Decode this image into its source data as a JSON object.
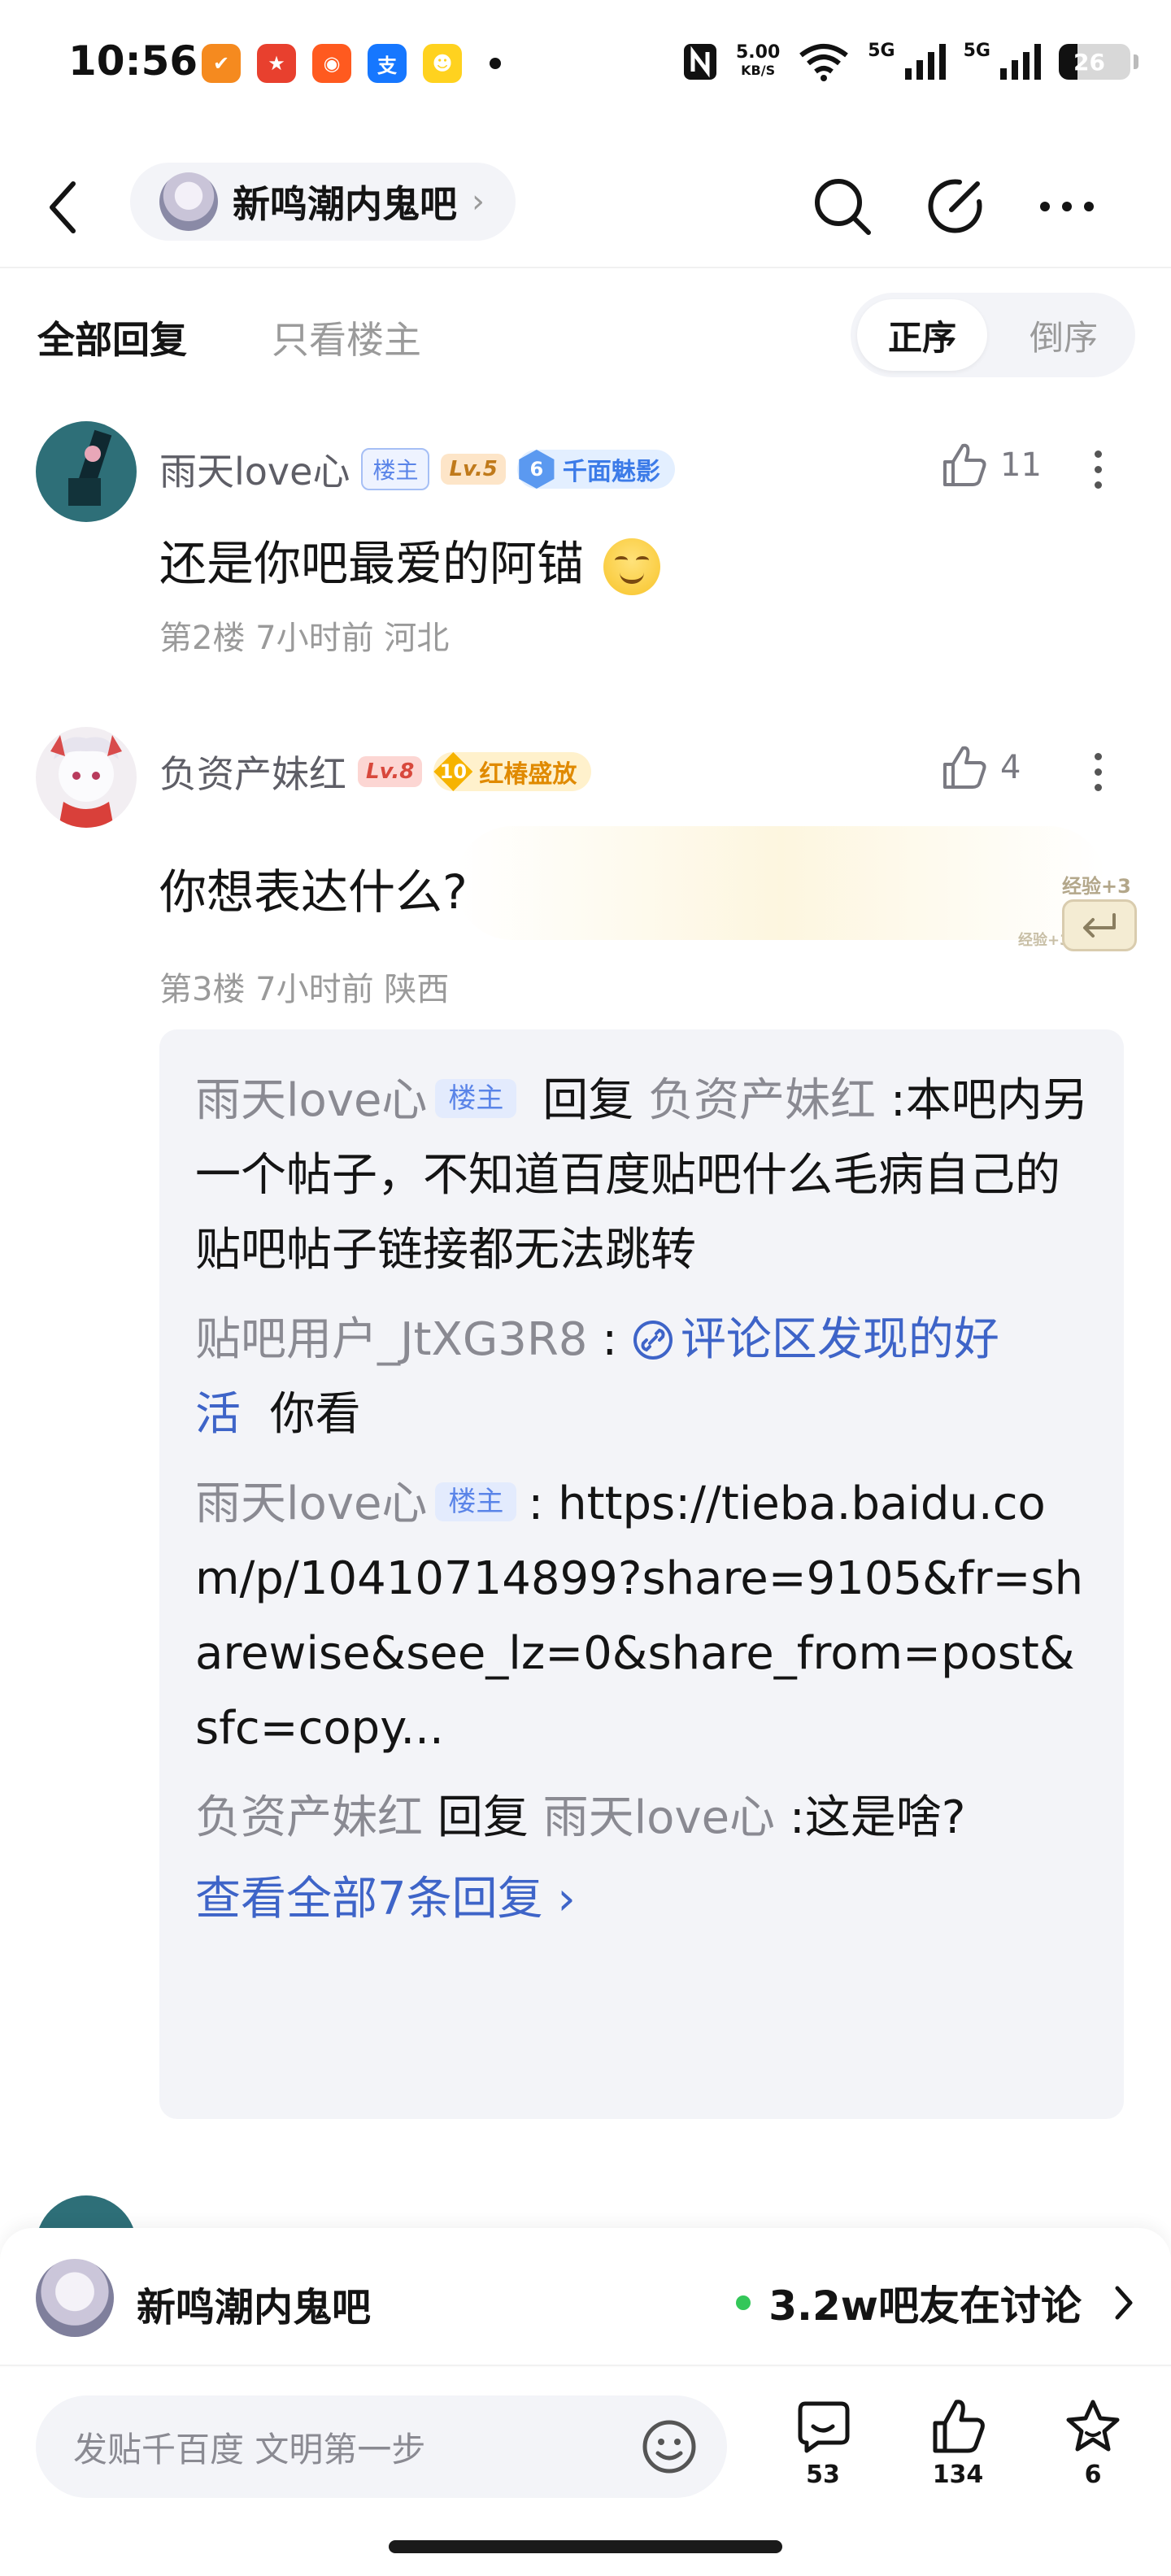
{
  "status_bar": {
    "time": "10:56",
    "net_speed": "5.00",
    "net_unit": "KB/S",
    "signal_1": "5G",
    "signal_2": "5G",
    "battery": "26",
    "battery_percent": 26,
    "app_icons": [
      {
        "name": "app-icon-orange",
        "color": "#f58a1f",
        "glyph": "✔"
      },
      {
        "name": "app-icon-game",
        "color": "#e8402e",
        "glyph": "★"
      },
      {
        "name": "app-icon-shop",
        "color": "#ff5a1f",
        "glyph": "◉"
      },
      {
        "name": "app-icon-alipay",
        "color": "#1677ff",
        "glyph": "支"
      },
      {
        "name": "app-icon-yellow",
        "color": "#ffd21f",
        "glyph": "☻"
      }
    ]
  },
  "header": {
    "forum_name": "新鸣潮内鬼吧",
    "chevron": "›"
  },
  "tabs": {
    "all_replies": "全部回复",
    "only_op": "只看楼主",
    "order_asc": "正序",
    "order_desc": "倒序"
  },
  "posts": [
    {
      "username": "雨天love心",
      "lz_badge": "楼主",
      "level": "Lv.5",
      "medal_num": "6",
      "medal_name": "千面魅影",
      "likes": "11",
      "content": "还是你吧最爱的阿锚",
      "meta": "第2楼 7小时前 河北"
    },
    {
      "username": "负资产妹红",
      "level": "Lv.8",
      "medal_num": "10",
      "medal_name": "红椿盛放",
      "likes": "4",
      "content": "你想表达什么?",
      "meta": "第3楼 7小时前 陕西",
      "exp_tag": "经验+3",
      "exp_tag_small": "经验+3"
    }
  ],
  "sub_replies": {
    "r1_user": "雨天love心",
    "r1_lz": "楼主",
    "r1_reply_word": "回复",
    "r1_target": "负资产妹红",
    "r1_text": ":本吧内另一个帖子，不知道百度贴吧什么毛病自己的贴吧帖子链接都无法跳转",
    "r2_user": "贴吧用户_JtXG3R8",
    "r2_colon": " : ",
    "r2_link": "评论区发现的好活",
    "r2_text": "你看",
    "r3_user": "雨天love心",
    "r3_lz": "楼主",
    "r3_text": ": https://tieba.baidu.com/p/10410714899?share=9105&fr=sharewise&see_lz=0&share_from=post&sfc=copy...",
    "r4_user": "负资产妹红",
    "r4_reply_word": "回复",
    "r4_target": "雨天love心",
    "r4_text": ":这是啥?",
    "view_all": "查看全部7条回复 ›"
  },
  "forum_bar": {
    "name": "新鸣潮内鬼吧",
    "online": "3.2w吧友在讨论"
  },
  "input_bar": {
    "placeholder": "发贴千百度 文明第一步",
    "comments": "53",
    "likes": "134",
    "favorites": "6"
  },
  "colors": {
    "accent_link": "#3e64c8",
    "lz_badge": "#5a84e8",
    "online_dot": "#34c759"
  }
}
